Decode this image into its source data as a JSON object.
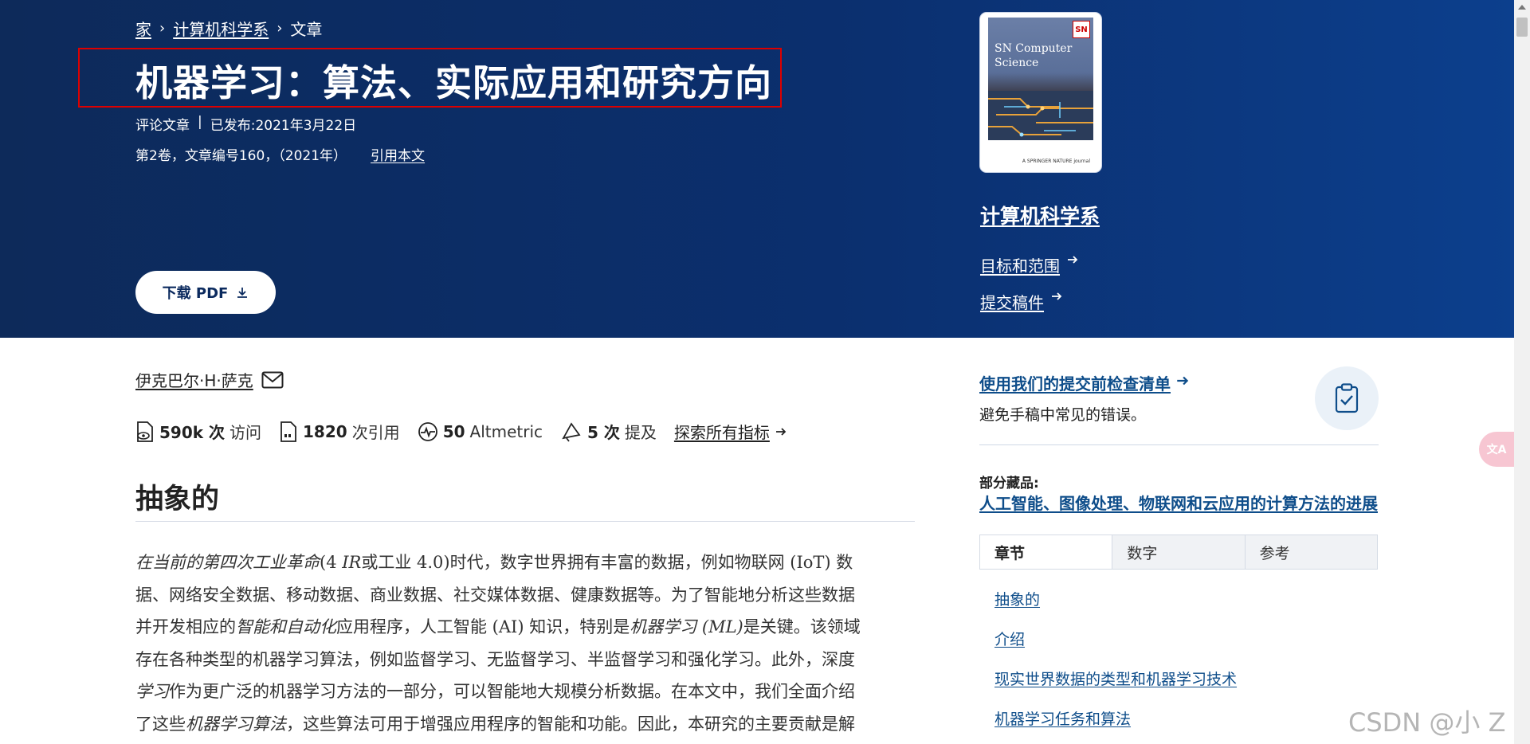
{
  "breadcrumb": {
    "home": "家",
    "section": "计算机科学系",
    "current": "文章",
    "separator": "›"
  },
  "article": {
    "title": "机器学习：算法、实际应用和研究方向",
    "type": "评论文章",
    "published": "已发布:2021年3月22日",
    "volume_info": "第2卷，文章编号160，（2021年）",
    "cite_link": "引用本文",
    "download_pdf": "下载 PDF",
    "author": "伊克巴尔·H·萨克"
  },
  "journal": {
    "cover_title": "SN Computer Science",
    "cover_badge": "SN",
    "cover_footer": "A SPRINGER NATURE journal",
    "name": "计算机科学系",
    "aims_link": "目标和范围",
    "submit_link": "提交稿件"
  },
  "metrics": {
    "accesses_value": "590k 次",
    "accesses_label": "访问",
    "citations_value": "1820",
    "citations_label": "次引用",
    "altmetric_value": "50",
    "altmetric_label": "Altmetric",
    "mentions_value": "5 次",
    "mentions_label": "提及",
    "explore_link": "探索所有指标"
  },
  "abstract": {
    "heading": "抽象的",
    "lines": [
      [
        "i:在当前的第四次工业革命",
        "(4 ",
        "i:IR",
        "或工业 4.0)时代，数字世界拥有丰富的数据，例如物联网 (IoT) 数"
      ],
      [
        "据、网络安全数据、移动数据、商业数据、社交媒体数据、健康数据等。为了智能地分析这些数据"
      ],
      [
        "并开发相应的",
        "i:智能和自动化",
        "应用程序，人工智能 (AI) 知识，特别是",
        "i:机器学习 (ML)",
        "是关键。该领域"
      ],
      [
        "存在各种类型的机器学习算法，例如监督学习、无监督学习、半监督学习和强化学习。此外，深度"
      ],
      [
        "i:学习",
        "作为更广泛的机器学习方法的一部分，可以智能地大规模分析数据。在本文中，我们全面介绍"
      ],
      [
        "了这些",
        "i:机器学习算法",
        "，这些算法可用于增强应用程序的智能和功能。因此，本研究的主要贡献是解"
      ]
    ]
  },
  "sidebar": {
    "checklist_title": "使用我们的提交前检查清单",
    "checklist_sub": "避免手稿中常见的错误。",
    "partial_label": "部分藏品:",
    "partial_link": "人工智能、图像处理、物联网和云应用的计算方法的进展",
    "tabs": [
      "章节",
      "数字",
      "参考"
    ],
    "toc": [
      "抽象的",
      "介绍",
      "现实世界数据的类型和机器学习技术",
      "机器学习任务和算法"
    ]
  },
  "overlay": {
    "translate_icon_text": "文A",
    "watermark": "CSDN @小 Z"
  },
  "colors": {
    "hero_start": "#0d2a5a",
    "hero_end": "#0c3f8d",
    "link_blue": "#0e4d8a",
    "highlight_red": "#dd0000"
  }
}
